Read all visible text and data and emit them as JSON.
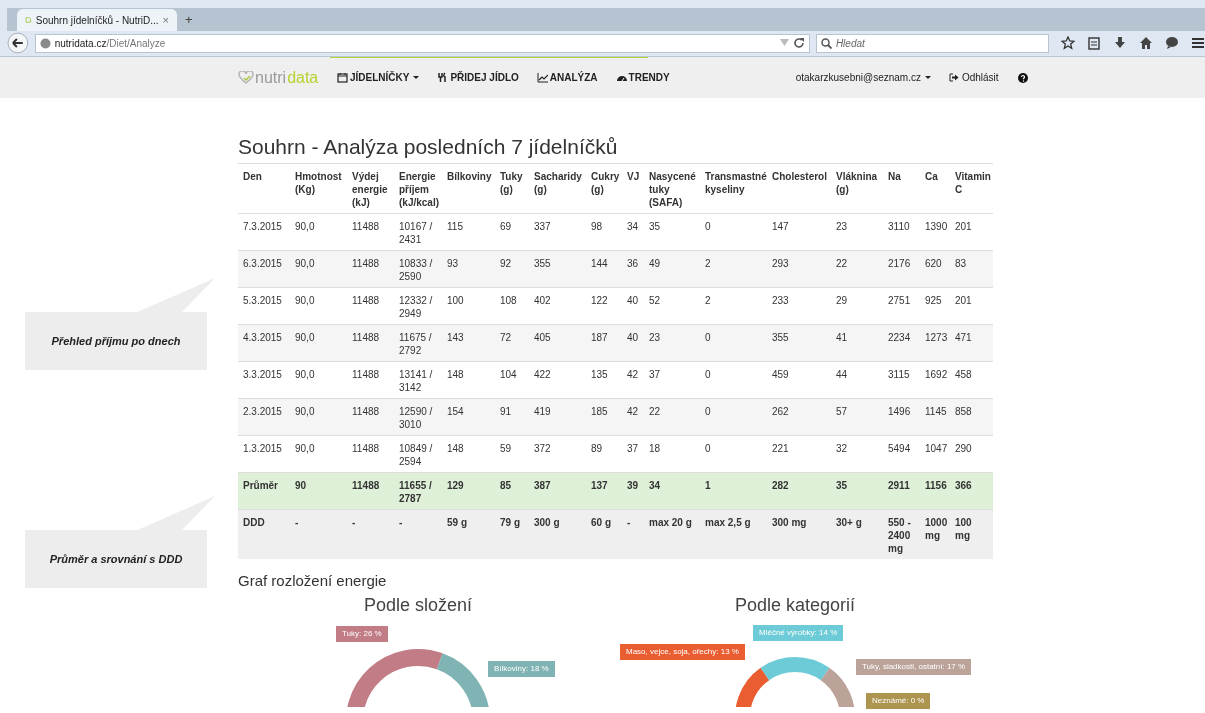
{
  "browser": {
    "tab": {
      "title": "Souhrn jídelníčků - NutriD...",
      "close": "×"
    },
    "new_tab": "+",
    "url_host": "nutridata.cz",
    "url_path": "/Diet/Analyze",
    "search_placeholder": "Hledat"
  },
  "navbar": {
    "logo_a": "nutri",
    "logo_b": "data",
    "items": [
      {
        "label": "JÍDELNÍČKY",
        "kind": "dropdown"
      },
      {
        "label": "PŘIDEJ JÍDLO",
        "kind": "link"
      },
      {
        "label": "ANALÝZA",
        "kind": "link"
      },
      {
        "label": "TRENDY",
        "kind": "link"
      }
    ],
    "user": "otakarzkusebni@seznam.cz",
    "logout": "Odhlásit"
  },
  "title": "Souhrn - Analýza posledních 7 jídelníčků",
  "table": {
    "columns": [
      "Den",
      "Hmotnost (Kg)",
      "Výdej energie (kJ)",
      "Energie příjem (kJ/kcal)",
      "Bílkoviny",
      "Tuky (g)",
      "Sacharidy (g)",
      "Cukry (g)",
      "VJ",
      "Nasycené tuky (SAFA)",
      "Transmastné kyseliny",
      "Cholesterol",
      "Vláknina (g)",
      "Na",
      "Ca",
      "Vitamin C"
    ],
    "rows": [
      {
        "kind": "data",
        "cells": [
          "7.3.2015",
          "90,0",
          "11488",
          "10167 / 2431",
          "115",
          "69",
          "337",
          "98",
          "34",
          "35",
          "0",
          "147",
          "23",
          "3110",
          "1390",
          "201"
        ]
      },
      {
        "kind": "data",
        "cells": [
          "6.3.2015",
          "90,0",
          "11488",
          "10833 / 2590",
          "93",
          "92",
          "355",
          "144",
          "36",
          "49",
          "2",
          "293",
          "22",
          "2176",
          "620",
          "83"
        ]
      },
      {
        "kind": "data",
        "cells": [
          "5.3.2015",
          "90,0",
          "11488",
          "12332 / 2949",
          "100",
          "108",
          "402",
          "122",
          "40",
          "52",
          "2",
          "233",
          "29",
          "2751",
          "925",
          "201"
        ]
      },
      {
        "kind": "data",
        "cells": [
          "4.3.2015",
          "90,0",
          "11488",
          "11675 / 2792",
          "143",
          "72",
          "405",
          "187",
          "40",
          "23",
          "0",
          "355",
          "41",
          "2234",
          "1273",
          "471"
        ]
      },
      {
        "kind": "data",
        "cells": [
          "3.3.2015",
          "90,0",
          "11488",
          "13141 / 3142",
          "148",
          "104",
          "422",
          "135",
          "42",
          "37",
          "0",
          "459",
          "44",
          "3115",
          "1692",
          "458"
        ]
      },
      {
        "kind": "data",
        "cells": [
          "2.3.2015",
          "90,0",
          "11488",
          "12590 / 3010",
          "154",
          "91",
          "419",
          "185",
          "42",
          "22",
          "0",
          "262",
          "57",
          "1496",
          "1145",
          "858"
        ]
      },
      {
        "kind": "data",
        "cells": [
          "1.3.2015",
          "90,0",
          "11488",
          "10849 / 2594",
          "148",
          "59",
          "372",
          "89",
          "37",
          "18",
          "0",
          "221",
          "32",
          "5494",
          "1047",
          "290"
        ]
      },
      {
        "kind": "average",
        "cells": [
          "Průměr",
          "90",
          "11488",
          "11655 / 2787",
          "129",
          "85",
          "387",
          "137",
          "39",
          "34",
          "1",
          "282",
          "35",
          "2911",
          "1156",
          "366"
        ]
      },
      {
        "kind": "reference",
        "cells": [
          "DDD",
          "-",
          "-",
          "-",
          "59 g",
          "79 g",
          "300 g",
          "60 g",
          "-",
          "max 20 g",
          "max 2,5 g",
          "300 mg",
          "30+ g",
          "550 - 2400 mg",
          "1000 mg",
          "100 mg"
        ]
      }
    ]
  },
  "callouts": [
    "Přehled příjmu po dnech",
    "Průměr a srovnání s DDD"
  ],
  "charts_heading": "Graf rozložení energie",
  "charts": [
    {
      "title": "Podle složení",
      "labels": [
        {
          "text": "Tuky: 26 %",
          "color": "#c17c85"
        },
        {
          "text": "Bílkoviny: 18 %",
          "color": "#80b3b3"
        }
      ]
    },
    {
      "title": "Podle kategorií",
      "labels": [
        {
          "text": "Maso, vejce, soja, ořechy: 13 %",
          "color": "#e95d31"
        },
        {
          "text": "Mléčné výrobky: 14 %",
          "color": "#6ccbd6"
        },
        {
          "text": "Tuky, sladkosti, ostatní: 17 %",
          "color": "#bba39a"
        },
        {
          "text": "Neznámé: 0 %",
          "color": "#ad9550"
        }
      ]
    }
  ]
}
